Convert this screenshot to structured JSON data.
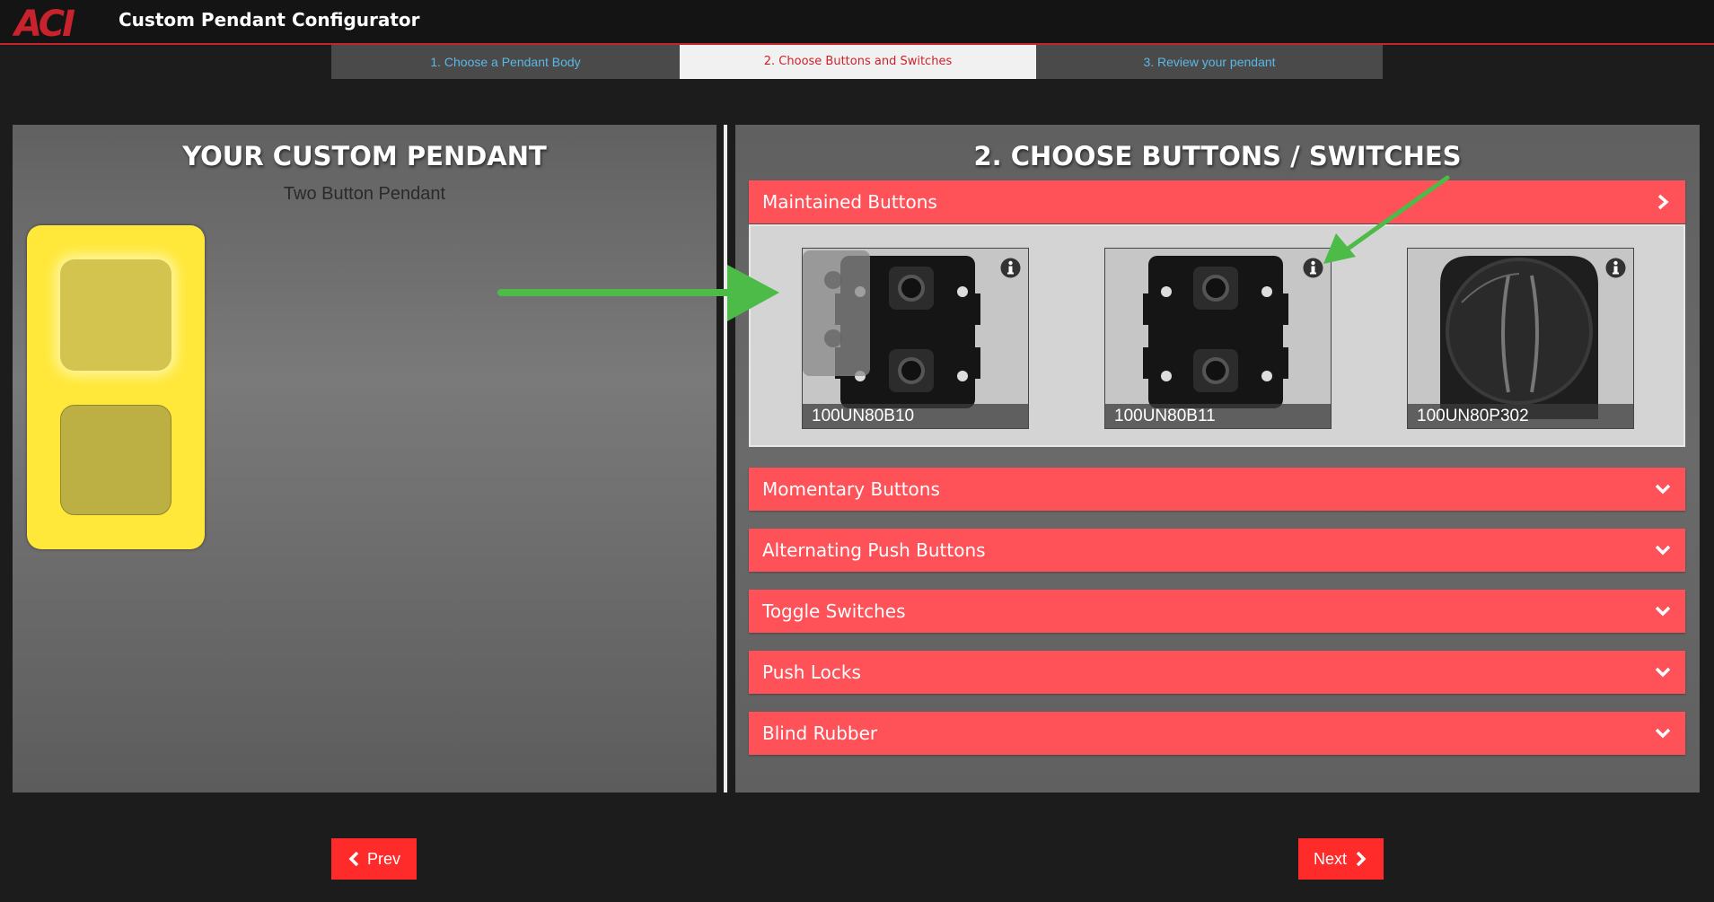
{
  "header": {
    "logo_text": "ACI",
    "app_title": "Custom Pendant Configurator"
  },
  "steps": [
    {
      "label": "1. Choose a Pendant Body",
      "active": false
    },
    {
      "label": "2. Choose Buttons and Switches",
      "active": true
    },
    {
      "label": "3. Review your pendant",
      "active": false
    }
  ],
  "left_panel": {
    "heading": "YOUR CUSTOM PENDANT",
    "pendant_name": "Two Button Pendant",
    "body_color": "#ffe83a"
  },
  "right_panel": {
    "heading": "2. CHOOSE BUTTONS / SWITCHES",
    "categories": [
      {
        "label": "Maintained Buttons",
        "expanded": true,
        "icon": "chevron-right-icon",
        "products": [
          {
            "code": "100UN80B10",
            "info_icon": "info-icon"
          },
          {
            "code": "100UN80B11",
            "info_icon": "info-icon"
          },
          {
            "code": "100UN80P302",
            "info_icon": "info-icon"
          }
        ]
      },
      {
        "label": "Momentary Buttons",
        "expanded": false,
        "icon": "chevron-down-icon"
      },
      {
        "label": "Alternating Push Buttons",
        "expanded": false,
        "icon": "chevron-down-icon"
      },
      {
        "label": "Toggle Switches",
        "expanded": false,
        "icon": "chevron-down-icon"
      },
      {
        "label": "Push Locks",
        "expanded": false,
        "icon": "chevron-down-icon"
      },
      {
        "label": "Blind Rubber",
        "expanded": false,
        "icon": "chevron-down-icon"
      }
    ]
  },
  "nav": {
    "prev_label": "Prev",
    "next_label": "Next"
  },
  "colors": {
    "accent": "#ff5158",
    "brand_red": "#c8232c",
    "button_red": "#ff2a2a",
    "annotation_green": "#4cbb47"
  }
}
